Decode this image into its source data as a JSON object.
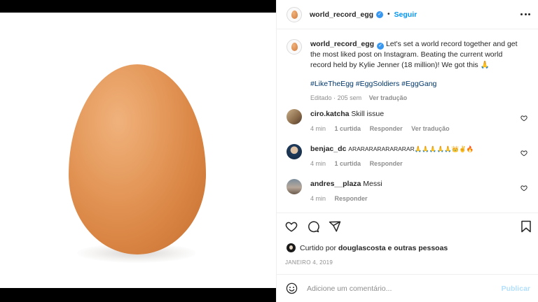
{
  "post": {
    "username": "world_record_egg",
    "verified": true,
    "follow_label": "Seguir",
    "dot": "•"
  },
  "caption": {
    "username": "world_record_egg",
    "text": "Let's set a world record together and get the most liked post on Instagram. Beating the current world record held by Kylie Jenner (18 million)! We got this 🙏",
    "hashtags": "#LikeTheEgg #EggSoldiers #EggGang",
    "edited_label": "Editado",
    "meta_sep": "·",
    "age": "205 sem",
    "translation_label": "Ver tradução"
  },
  "comments": [
    {
      "username": "ciro.katcha",
      "text": "Skill issue",
      "age": "4 min",
      "likes": "1 curtida",
      "reply_label": "Responder",
      "translation_label": "Ver tradução"
    },
    {
      "username": "benjac_dc",
      "text": "ARARARARARARARAR🙏🙏🙏🙏🙏👑✌🔥",
      "age": "4 min",
      "likes": "1 curtida",
      "reply_label": "Responder"
    },
    {
      "username": "andres__plaza",
      "text": "Messi",
      "age": "4 min",
      "reply_label": "Responder"
    }
  ],
  "liked_by": {
    "prefix": "Curtido por",
    "user": "douglascosta",
    "suffix": "e outras pessoas"
  },
  "date": "JANEIRO 4, 2019",
  "add_comment": {
    "placeholder": "Adicione um comentário...",
    "publish_label": "Publicar"
  },
  "icons": {
    "like": "heart-icon",
    "comment": "comment-icon",
    "share": "share-icon",
    "save": "bookmark-icon",
    "emoji": "emoji-icon",
    "more": "more-icon"
  },
  "colors": {
    "link_blue": "#0095f6",
    "hashtag_blue": "#00376b",
    "muted": "#8e8e8e",
    "publish_disabled": "#b2dffc"
  }
}
